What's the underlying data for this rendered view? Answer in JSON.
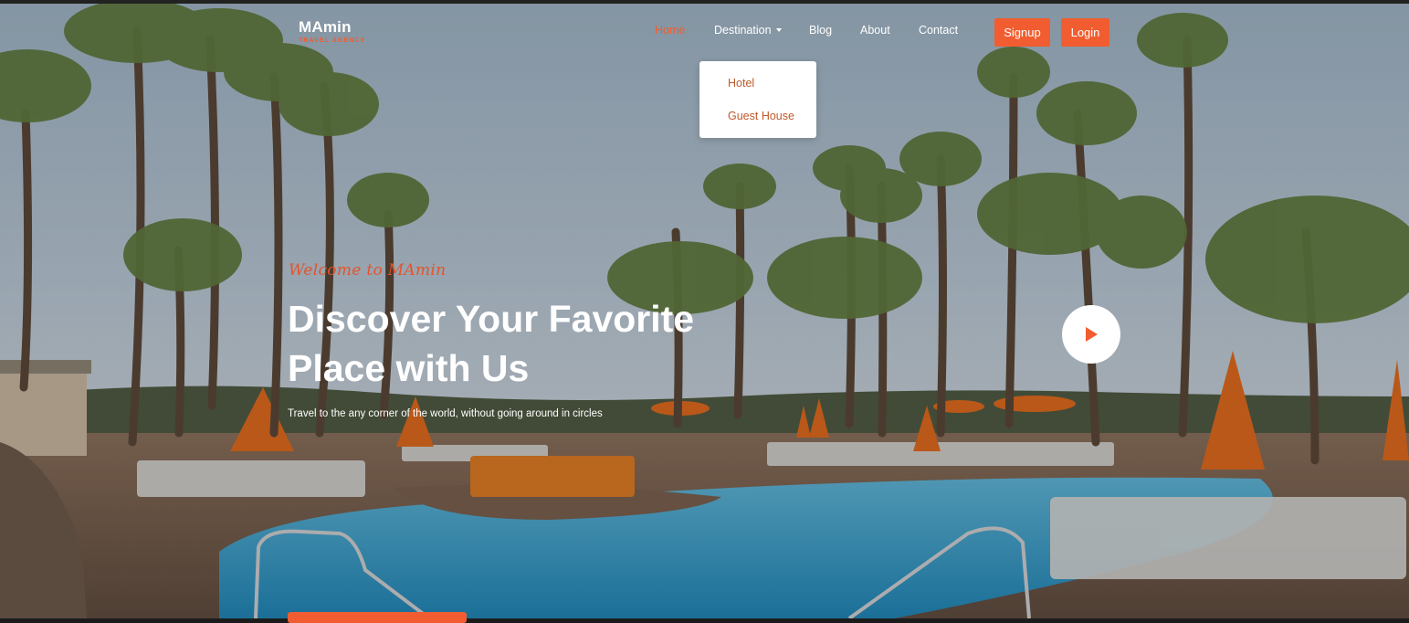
{
  "brand": {
    "name": "MAmin",
    "tagline": "TRAVEL AGENCY"
  },
  "nav": {
    "items": [
      {
        "label": "Home",
        "active": true
      },
      {
        "label": "Destination",
        "has_dropdown": true
      },
      {
        "label": "Blog"
      },
      {
        "label": "About"
      },
      {
        "label": "Contact"
      }
    ],
    "signup_label": "Signup",
    "login_label": "Login"
  },
  "dropdown": {
    "items": [
      "Hotel",
      "Guest House"
    ]
  },
  "hero": {
    "welcome": "Welcome to MAmin",
    "headline_line1": "Discover Your Favorite",
    "headline_line2": "Place with Us",
    "subtitle": "Travel to the any corner of the world, without going around in circles",
    "play_icon": "play-icon"
  },
  "colors": {
    "accent": "#f15d30",
    "dropdown_text": "#c05a2a",
    "text": "#ffffff"
  }
}
